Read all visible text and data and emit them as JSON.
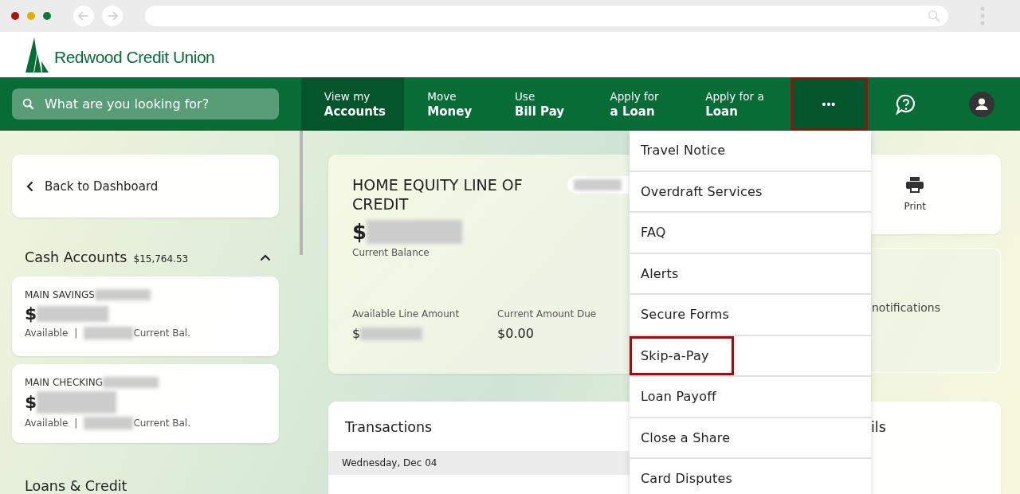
{
  "brand": {
    "name": "Redwood Credit Union"
  },
  "search": {
    "placeholder": "What are you looking for?"
  },
  "nav": [
    {
      "line1": "View my",
      "line2": "Accounts",
      "selected": true
    },
    {
      "line1": "Move",
      "line2": "Money",
      "selected": false
    },
    {
      "line1": "Use",
      "line2": "Bill Pay",
      "selected": false
    },
    {
      "line1": "Apply for",
      "line2": "a Loan",
      "selected": false
    },
    {
      "line1": "Apply for a",
      "line2": "Loan",
      "selected": false
    }
  ],
  "more_button": {
    "label": "•••",
    "open": true,
    "highlighted": true
  },
  "sidebar": {
    "back_label": "Back to Dashboard",
    "section": {
      "title": "Cash Accounts",
      "total": "$15,764.53",
      "expanded": true
    },
    "accounts": [
      {
        "name": "MAIN SAVINGS",
        "currency": "$",
        "available_label": "Available",
        "separator": "|",
        "current_label": "Current Bal."
      },
      {
        "name": "MAIN CHECKING",
        "currency": "$",
        "available_label": "Available",
        "separator": "|",
        "current_label": "Current Bal."
      }
    ],
    "next_section": "Loans & Credit"
  },
  "account_card": {
    "title": "HOME EQUITY LINE OF CREDIT",
    "currency": "$",
    "balance_label": "Current Balance",
    "stats": [
      {
        "label": "Available Line Amount",
        "kind": "redacted",
        "currency": "$"
      },
      {
        "label": "Current Amount Due",
        "kind": "value",
        "value": "$0.00"
      }
    ]
  },
  "transactions": {
    "title": "Transactions",
    "date_header": "Wednesday, Dec 04"
  },
  "side_panels": {
    "print_label": "Print",
    "notifications_text": "notifications",
    "details_title": "ils"
  },
  "menu": [
    {
      "label": "Travel Notice",
      "highlighted": false
    },
    {
      "label": "Overdraft Services",
      "highlighted": false
    },
    {
      "label": "FAQ",
      "highlighted": false
    },
    {
      "label": "Alerts",
      "highlighted": false
    },
    {
      "label": "Secure Forms",
      "highlighted": false
    },
    {
      "label": "Skip-a-Pay",
      "highlighted": true
    },
    {
      "label": "Loan Payoff",
      "highlighted": false
    },
    {
      "label": "Close a Share",
      "highlighted": false
    },
    {
      "label": "Card Disputes",
      "highlighted": false
    }
  ]
}
